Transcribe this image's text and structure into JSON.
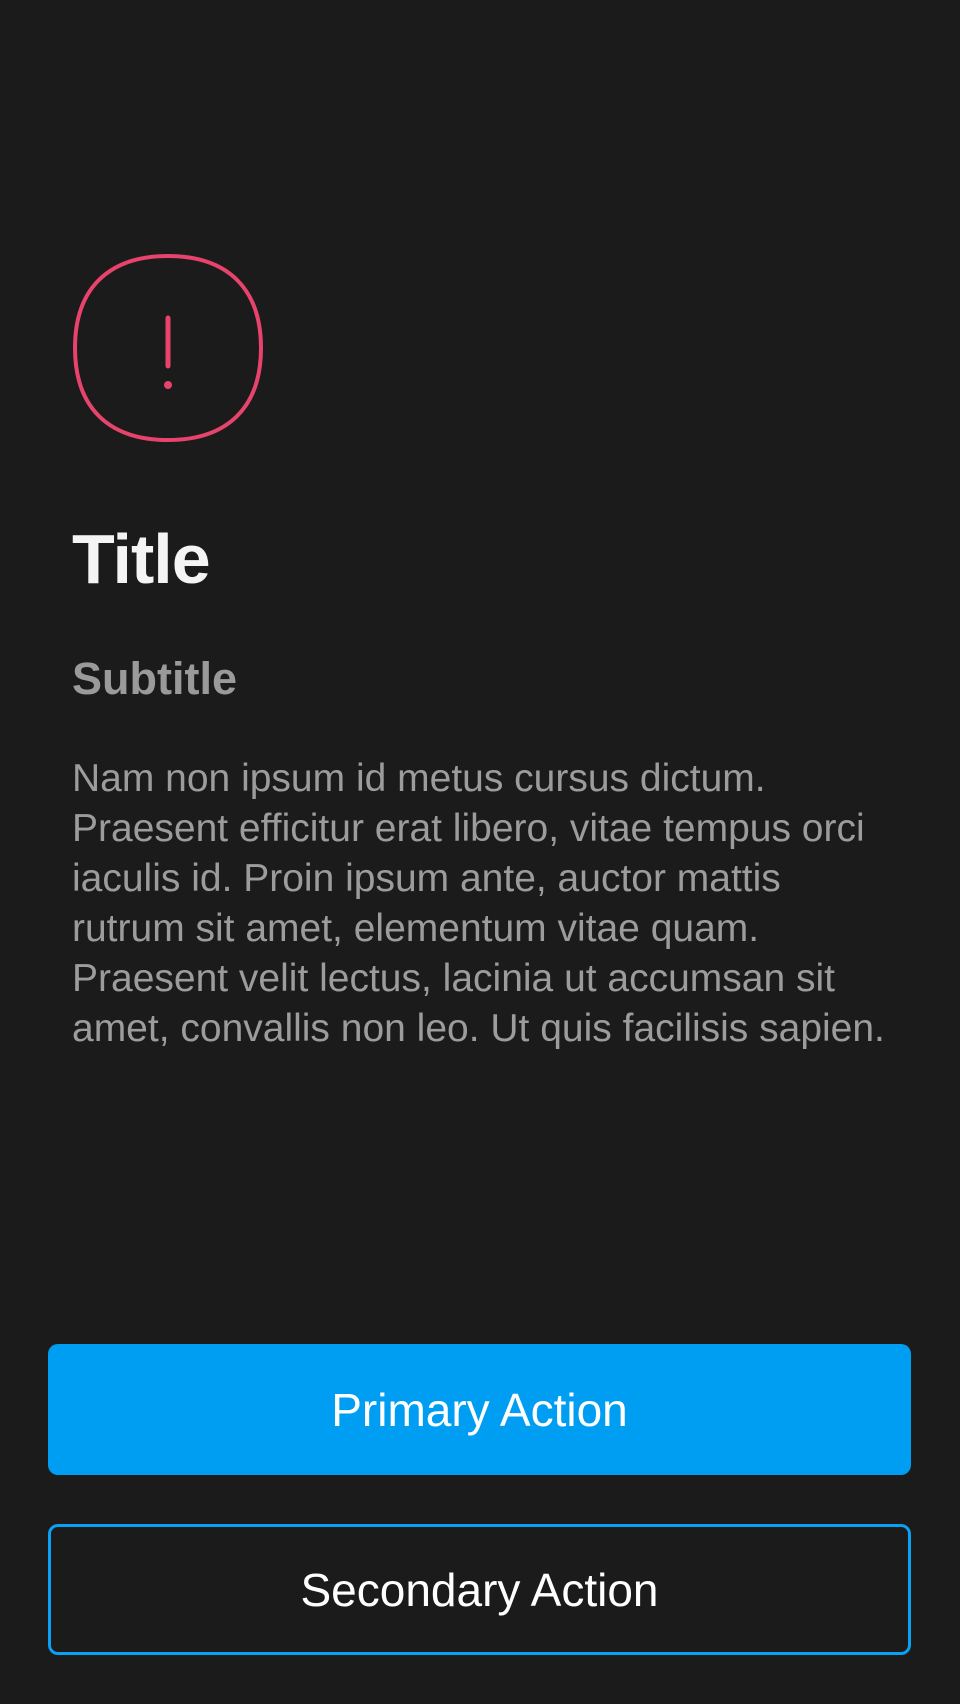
{
  "icon": {
    "name": "alert-exclamation-icon",
    "color": "#e8436d"
  },
  "content": {
    "title": "Title",
    "subtitle": "Subtitle",
    "body": "Nam non ipsum id metus cursus dictum. Praesent efficitur erat libero, vitae tempus orci iaculis id. Proin ipsum ante, auctor mattis rutrum sit amet, elementum vitae quam. Praesent velit lectus, lacinia ut accumsan sit amet, convallis non leo. Ut quis facilisis sapien."
  },
  "actions": {
    "primary_label": "Primary Action",
    "secondary_label": "Secondary Action"
  },
  "colors": {
    "background": "#1b1b1b",
    "accent": "#009ef3",
    "alert": "#e8436d",
    "title_text": "#f4f4f4",
    "muted_text": "#9c9c9c"
  }
}
